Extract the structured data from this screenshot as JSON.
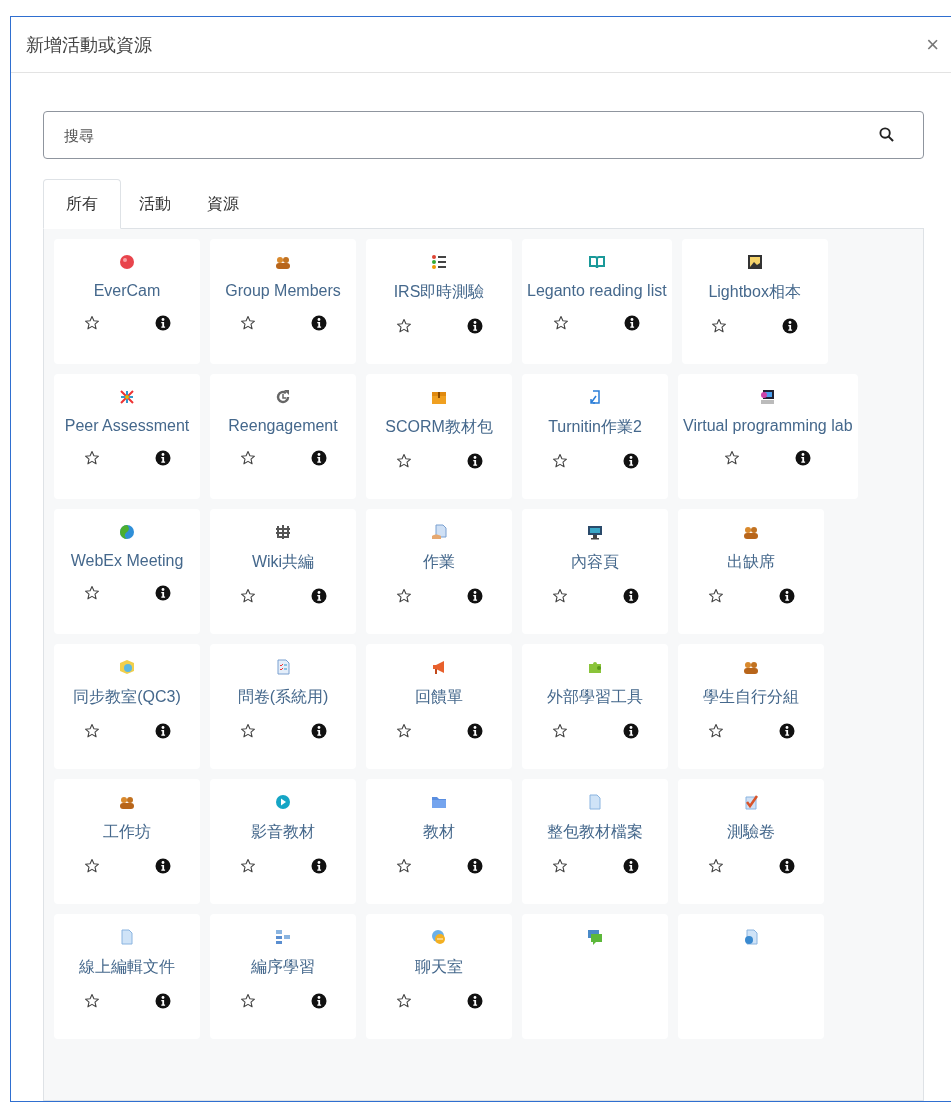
{
  "dialog": {
    "title": "新增活動或資源",
    "close": "×"
  },
  "search": {
    "placeholder": "搜尋"
  },
  "tabs": [
    {
      "label": "所有",
      "selected": true
    },
    {
      "label": "活動",
      "selected": false
    },
    {
      "label": "資源",
      "selected": false
    }
  ],
  "items": [
    {
      "label": "EverCam",
      "starred": false
    },
    {
      "label": "Group Members",
      "starred": false
    },
    {
      "label": "IRS即時測驗",
      "starred": false
    },
    {
      "label": "Leganto reading list",
      "starred": false
    },
    {
      "label": "Lightbox相本",
      "starred": false
    },
    {
      "label": "Peer Assessment",
      "starred": false
    },
    {
      "label": "Reengagement",
      "starred": false
    },
    {
      "label": "SCORM教材包",
      "starred": false
    },
    {
      "label": "Turnitin作業2",
      "starred": false
    },
    {
      "label": "Virtual programming lab",
      "starred": false
    },
    {
      "label": "WebEx Meeting",
      "starred": false
    },
    {
      "label": "Wiki共編",
      "starred": false
    },
    {
      "label": "作業",
      "starred": false
    },
    {
      "label": "內容頁",
      "starred": false
    },
    {
      "label": "出缺席",
      "starred": false
    },
    {
      "label": "同步教室(QC3)",
      "starred": false
    },
    {
      "label": "問卷(系統用)",
      "starred": false
    },
    {
      "label": "回饋單",
      "starred": false
    },
    {
      "label": "外部學習工具",
      "starred": false
    },
    {
      "label": "學生自行分組",
      "starred": false
    },
    {
      "label": "工作坊",
      "starred": false
    },
    {
      "label": "影音教材",
      "starred": false
    },
    {
      "label": "教材",
      "starred": false
    },
    {
      "label": "整包教材檔案",
      "starred": false
    },
    {
      "label": "測驗卷",
      "starred": false
    },
    {
      "label": "線上編輯文件",
      "starred": false
    },
    {
      "label": "編序學習",
      "starred": false
    },
    {
      "label": "聊天室",
      "starred": false
    },
    {
      "kind": "partial"
    },
    {
      "kind": "partial"
    }
  ]
}
